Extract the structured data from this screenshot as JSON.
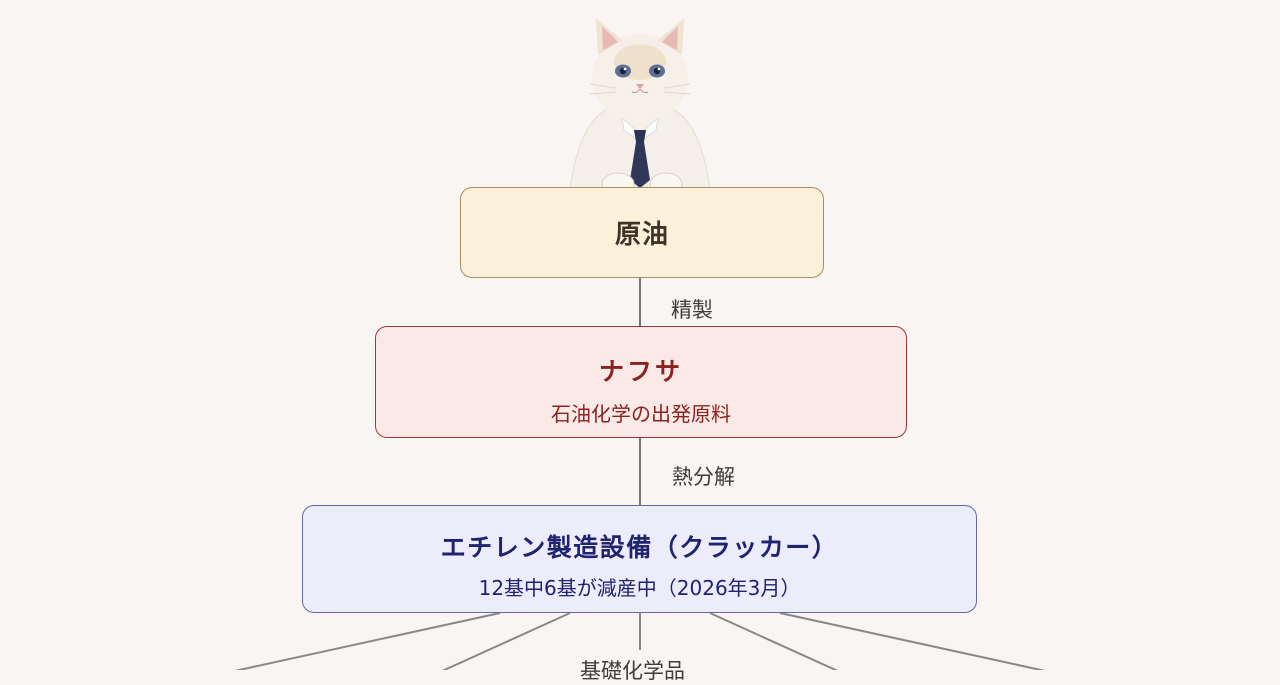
{
  "diagram": {
    "nodes": {
      "crude_oil": {
        "title": "原油"
      },
      "naphtha": {
        "title": "ナフサ",
        "subtitle": "石油化学の出発原料"
      },
      "cracker": {
        "title": "エチレン製造設備（クラッカー）",
        "subtitle": "12基中6基が減産中（2026年3月）"
      }
    },
    "edges": {
      "refining": "精製",
      "cracking": "熱分解",
      "basic_chemicals": "基礎化学品"
    }
  },
  "colors": {
    "background": "#f8f5f2",
    "crude_fill": "#fbf0da",
    "naphtha_fill": "#fbe9e7",
    "cracker_fill": "#ececfb",
    "connector": "#7a7a7a"
  }
}
